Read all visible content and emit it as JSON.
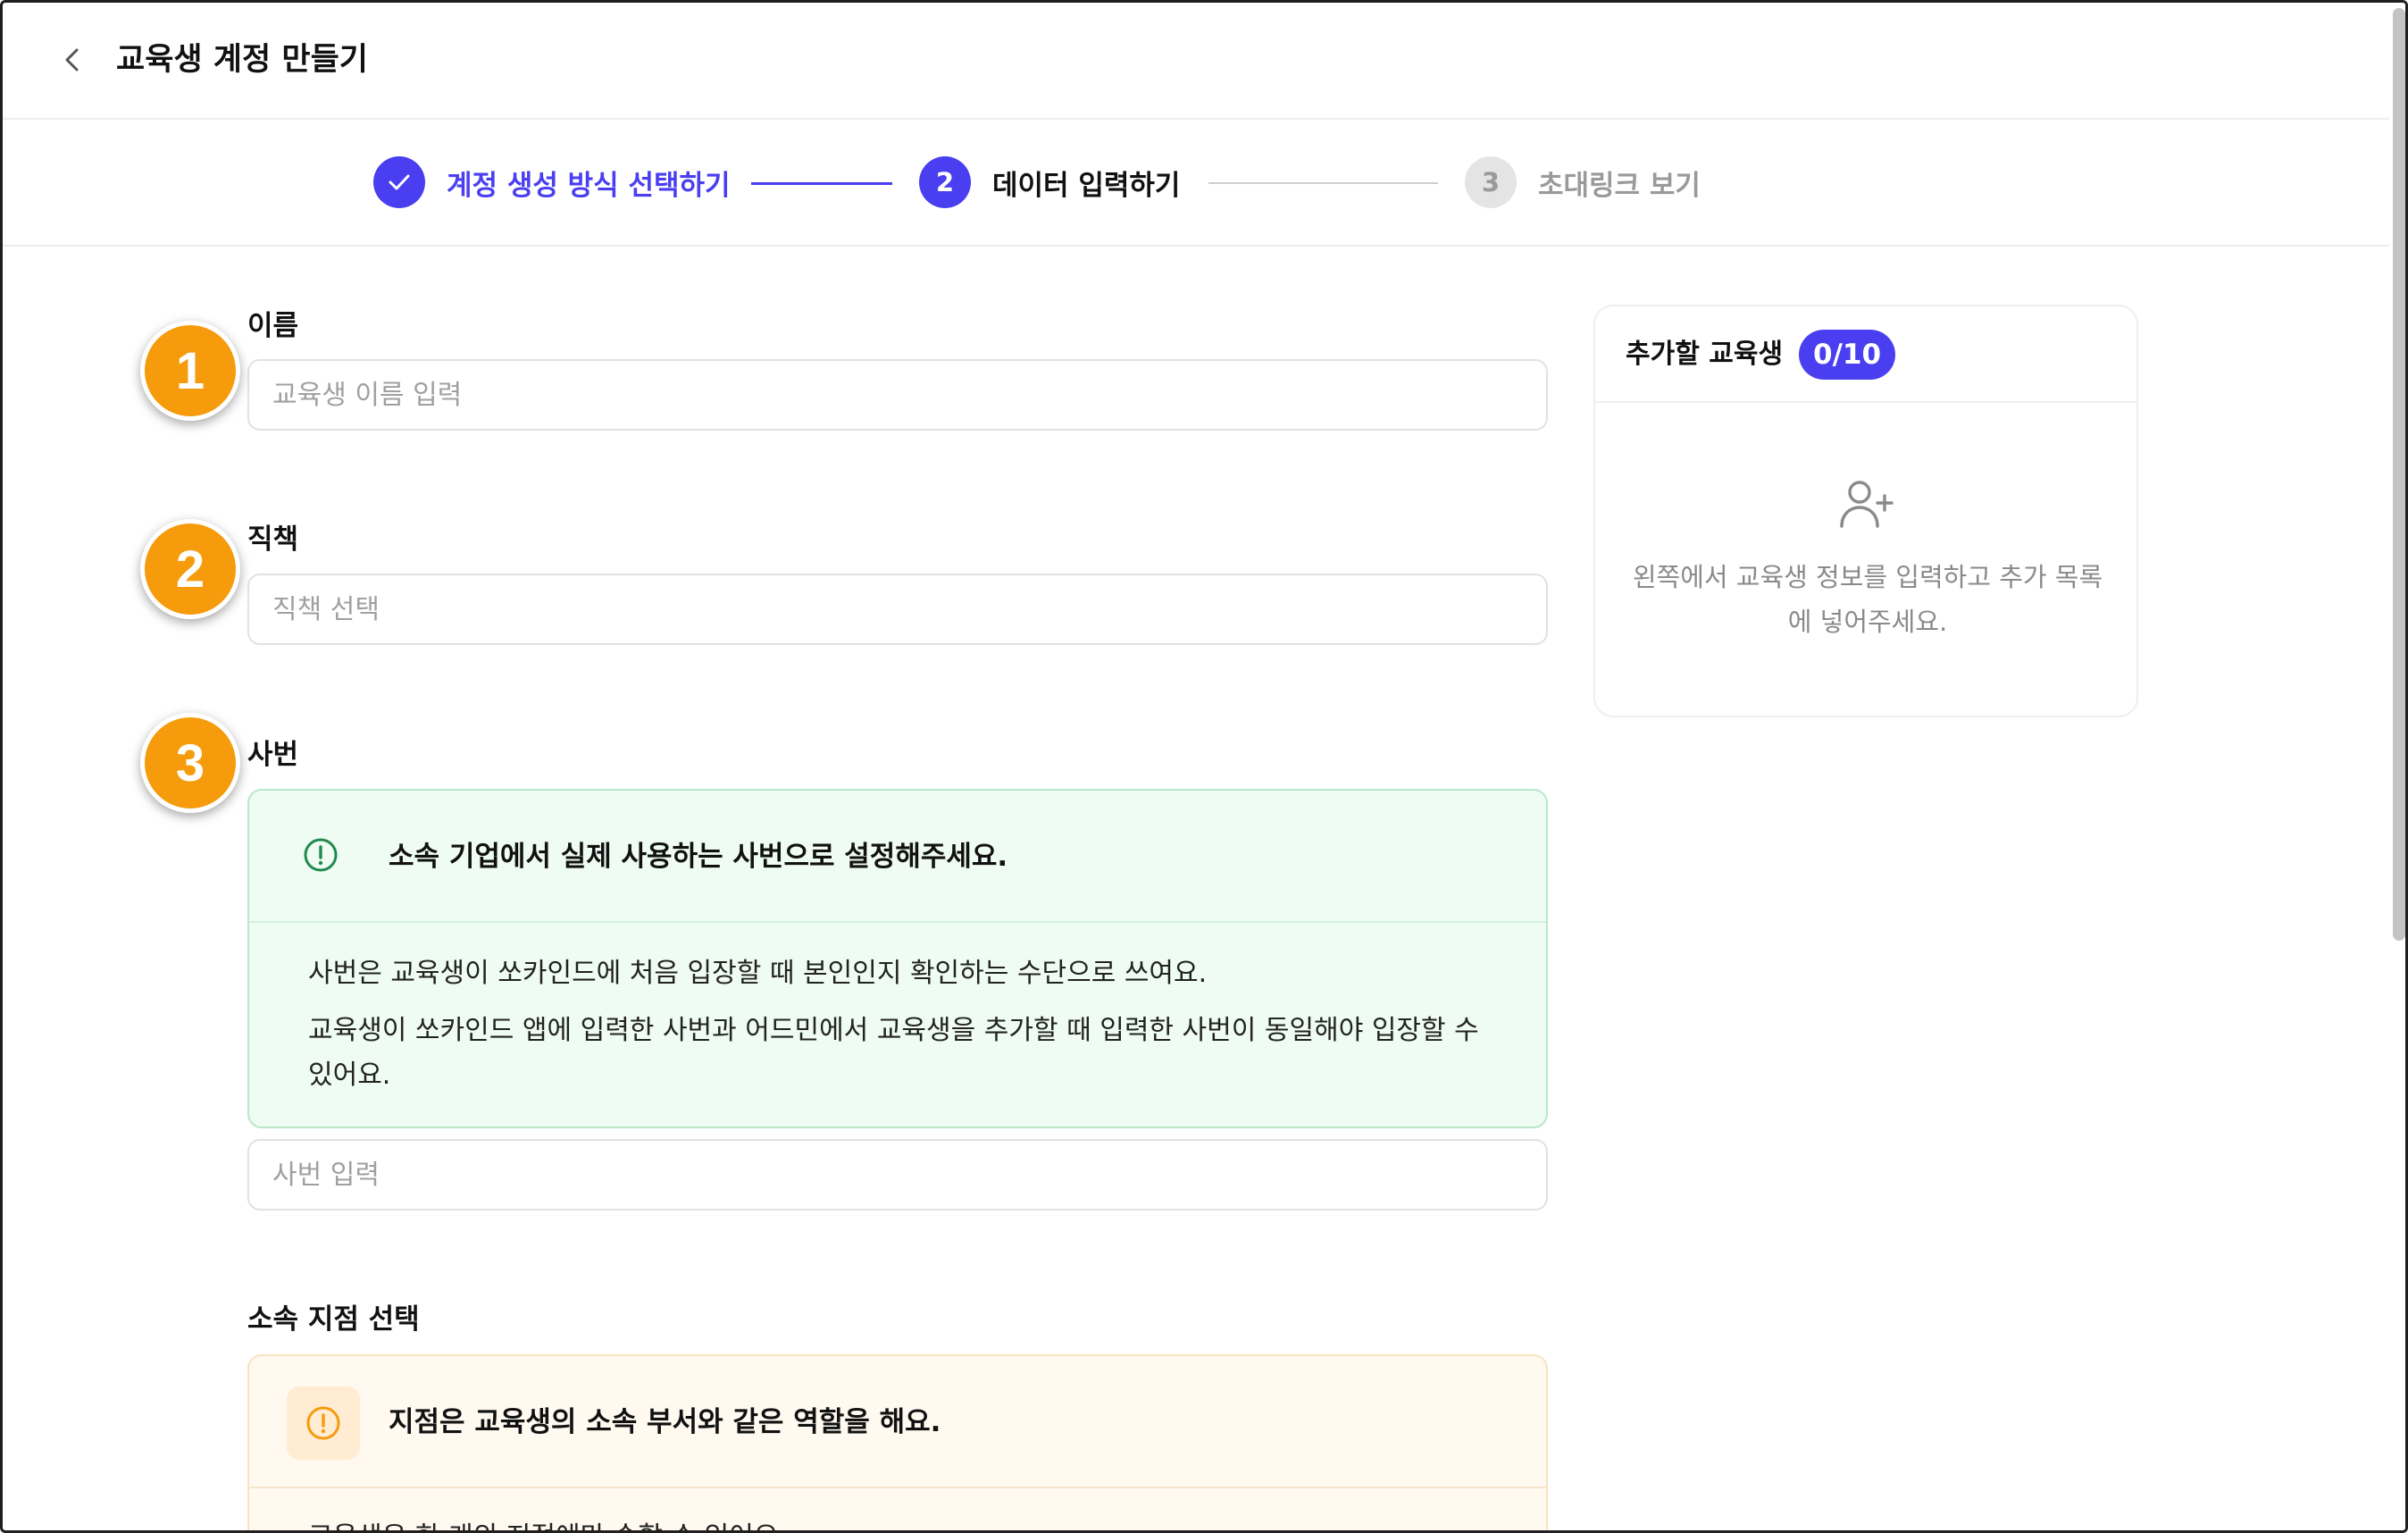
{
  "header": {
    "title": "교육생 계정 만들기",
    "back_icon": "chevron-left-icon"
  },
  "stepper": {
    "steps": [
      {
        "number": "",
        "label": "계정 생성 방식 선택하기",
        "state": "completed",
        "icon": "check-icon"
      },
      {
        "number": "2",
        "label": "데이터 입력하기",
        "state": "active"
      },
      {
        "number": "3",
        "label": "초대링크 보기",
        "state": "upcoming"
      }
    ],
    "accent_color": "#4a3ff0"
  },
  "form": {
    "name": {
      "label": "이름",
      "placeholder": "교육생 이름 입력"
    },
    "position": {
      "label": "직책",
      "placeholder": "직책 선택"
    },
    "employee_id": {
      "label": "사번",
      "notice_title": "소속 기업에서 실제 사용하는 사번으로 설정해주세요.",
      "notice_line_1": "사번은 교육생이 쏘카인드에 처음 입장할 때 본인인지 확인하는 수단으로 쓰여요.",
      "notice_line_2": "교육생이 쏘카인드 앱에 입력한 사번과 어드민에서 교육생을 추가할 때 입력한 사번이 동일해야 입장할 수 있어요.",
      "placeholder": "사번 입력"
    },
    "branch": {
      "label": "소속 지점 선택",
      "notice_title": "지점은 교육생의 소속 부서와 같은 역할을 해요.",
      "notice_line_1": "교육생은 한 개의 지점에만 속할 수 있어요."
    }
  },
  "annotations": {
    "badge_1": "1",
    "badge_2": "2",
    "badge_3": "3",
    "badge_color": "#f59b0c"
  },
  "panel": {
    "title": "추가할 교육생",
    "count": "0/10",
    "empty_icon": "user-plus-icon",
    "empty_text": "왼쪽에서 교육생 정보를 입력하고 추가 목록에 넣어주세요."
  }
}
